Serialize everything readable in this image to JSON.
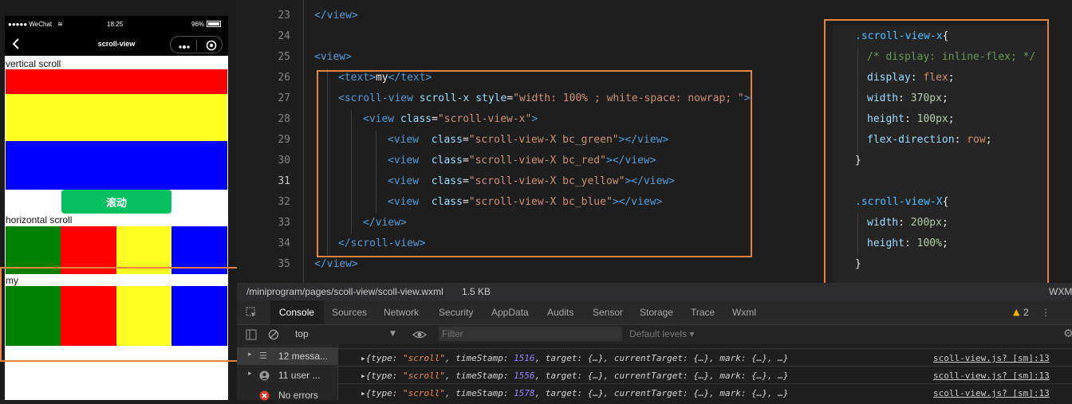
{
  "phone": {
    "status": {
      "carrier": "●●●●● WeChat",
      "wifi": "≋",
      "time": "18:25",
      "battery": "96%"
    },
    "nav": {
      "title": "scroll-view",
      "back_icon": "chevron-left-icon",
      "more_icon": "more-dots-icon",
      "close_icon": "target-circle-icon"
    },
    "vertical_label": "vertical scroll",
    "scroll_button": "滚动",
    "horizontal_label": "horizontal scroll",
    "my_label": "my",
    "colors": {
      "green": "#008000",
      "red": "#ff0000",
      "yellow": "#ffff22",
      "blue": "#0000ff",
      "button": "#07c160"
    }
  },
  "editor": {
    "line_numbers": [
      "23",
      "24",
      "25",
      "26",
      "27",
      "28",
      "29",
      "30",
      "31",
      "32",
      "33",
      "34",
      "35"
    ],
    "lines": [
      {
        "t1": "</",
        "tag": "view",
        "t2": ">"
      },
      {},
      {
        "t1": "<",
        "tag": "view",
        "t2": ">"
      },
      {
        "t1": "<",
        "tag": "text",
        "t2": ">",
        "text": "my",
        "t3": "</",
        "tag2": "text",
        "t4": ">"
      },
      {
        "t1": "<",
        "tag": "scroll-view",
        "attr1": "scroll-x",
        "attr2": "style",
        "eq": "=",
        "str": "\"width: 100% ; white-space: nowrap; \"",
        "t2": ">"
      },
      {
        "t1": "<",
        "tag": "view",
        "attr1": "class",
        "eq": "=",
        "str": "\"scroll-view-x\"",
        "t2": ">"
      },
      {
        "t1": "<",
        "tag": "view",
        "attr1": "class",
        "eq": "=",
        "str": "\"scroll-view-X bc_green\"",
        "t2": "></",
        "tag2": "view",
        "t3": ">"
      },
      {
        "t1": "<",
        "tag": "view",
        "attr1": "class",
        "eq": "=",
        "str": "\"scroll-view-X bc_red\"",
        "t2": "></",
        "tag2": "view",
        "t3": ">"
      },
      {
        "t1": "<",
        "tag": "view",
        "attr1": "class",
        "eq": "=",
        "str": "\"scroll-view-X bc_yellow\"",
        "t2": "></",
        "tag2": "view",
        "t3": ">"
      },
      {
        "t1": "<",
        "tag": "view",
        "attr1": "class",
        "eq": "=",
        "str": "\"scroll-view-X bc_blue\"",
        "t2": "></",
        "tag2": "view",
        "t3": ">"
      },
      {
        "t1": "</",
        "tag": "view",
        "t2": ">"
      },
      {
        "t1": "</",
        "tag": "scroll-view",
        "t2": ">"
      },
      {
        "t1": "</",
        "tag": "view",
        "t2": ">"
      }
    ],
    "css": {
      "sel1": ".scroll-view-x",
      "brace_open": "{",
      "comment": "/* display: inline-flex; */",
      "p1": "display",
      "v1": "flex",
      "p2": "width",
      "v2": "370px",
      "p3": "height",
      "v3": "100px",
      "p4": "flex-direction",
      "v4": "row",
      "brace_close": "}",
      "sel2": ".scroll-view-X",
      "p5": "width",
      "v5": "200px",
      "p6": "height",
      "v6": "100%",
      "colon": ":",
      "semi": ";"
    }
  },
  "filebar": {
    "path": "/miniprogram/pages/scoll-view/scoll-view.wxml",
    "size": "1.5 KB",
    "right": "WXML"
  },
  "devtools": {
    "tabs": [
      "Console",
      "Sources",
      "Network",
      "Security",
      "AppData",
      "Audits",
      "Sensor",
      "Storage",
      "Trace",
      "Wxml"
    ],
    "warnings": "2",
    "context": "top",
    "filter_placeholder": "Filter",
    "levels": "Default levels ▾",
    "sidebar": [
      {
        "label": "12 messa..."
      },
      {
        "label": "11 user ..."
      },
      {
        "label": "No errors"
      }
    ],
    "messages": [
      {
        "pre": "▸{type: ",
        "type": "\"scroll\"",
        "mid": ", timeStamp: ",
        "ts": "1516",
        "post": ", target: {…}, currentTarget: {…}, mark: {…}, …}",
        "src": "scoll-view.js? [sm]:13"
      },
      {
        "pre": "▸{type: ",
        "type": "\"scroll\"",
        "mid": ", timeStamp: ",
        "ts": "1556",
        "post": ", target: {…}, currentTarget: {…}, mark: {…}, …}",
        "src": "scoll-view.js? [sm]:13"
      },
      {
        "pre": "▸{type: ",
        "type": "\"scroll\"",
        "mid": ", timeStamp: ",
        "ts": "1578",
        "post": ", target: {…}, currentTarget: {…}, mark: {…}, …}",
        "src": "scoll-view.js? [sm]:13"
      }
    ]
  }
}
